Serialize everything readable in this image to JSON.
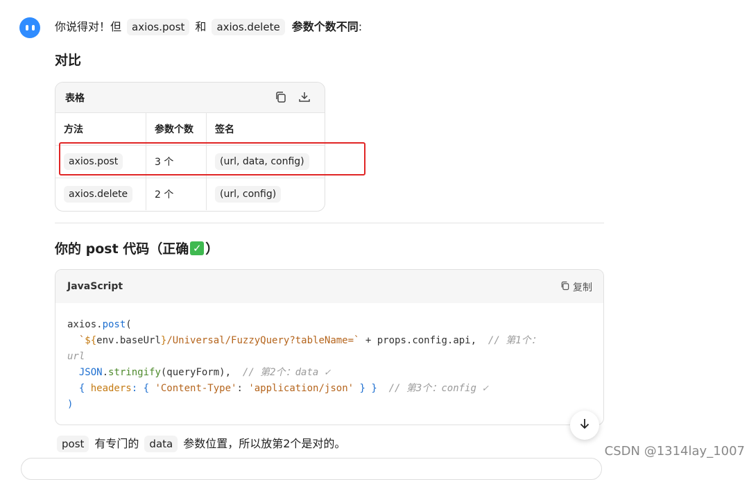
{
  "intro": {
    "prefix": "你说得对！但",
    "code1": "axios.post",
    "mid": "和",
    "code2": "axios.delete",
    "bold": "参数个数不同",
    "suffix": ":"
  },
  "compare_title": "对比",
  "table_card": {
    "label": "表格",
    "headers": [
      "方法",
      "参数个数",
      "签名"
    ],
    "rows": [
      {
        "method": "axios.post",
        "count": "3 个",
        "signature": "(url, data, config)"
      },
      {
        "method": "axios.delete",
        "count": "2 个",
        "signature": "(url, config)"
      }
    ]
  },
  "section2": {
    "title": "你的 post 代码（正确",
    "title_suffix": "）",
    "check_glyph": "✓"
  },
  "code_card": {
    "language": "JavaScript",
    "copy_label": "复制",
    "lines": {
      "l1a": "axios.",
      "l1b": "post",
      "l1c": "(",
      "l2_tick1": "`",
      "l2_interp": "${",
      "l2_env": "env.baseUrl",
      "l2_close": "}",
      "l2_path": "/Universal/FuzzyQuery?tableName=",
      "l2_tick2": "`",
      "l2_rest": " + props.config.api,",
      "l2_cmt": "// 第1个：",
      "l3_cmt": "url",
      "l4a": "JSON",
      "l4b": ".",
      "l4c": "stringify",
      "l4d": "(queryForm),",
      "l4_cmt": "// 第2个：data ✓",
      "l5a": "{ ",
      "l5b": "headers",
      "l5c": ": { ",
      "l5d": "'Content-Type'",
      "l5e": ": ",
      "l5f": "'application/json'",
      "l5g": " } }",
      "l5_cmt": "// 第3个：config ✓",
      "l6": ")"
    }
  },
  "footer": {
    "code1": "post",
    "text1": "有专门的",
    "code2": "data",
    "text2": "参数位置，所以放第2个是对的。"
  },
  "watermark_text": "CSDN @1314lay_1007",
  "colors": {
    "highlight_border": "#e02424",
    "avatar": "#2f8cff",
    "check": "#3fb950"
  }
}
